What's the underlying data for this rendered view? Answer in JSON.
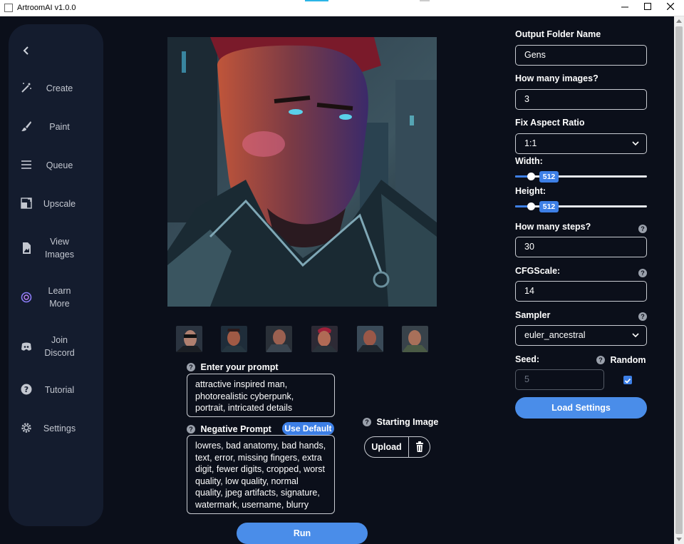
{
  "window": {
    "title": "ArtroomAI v1.0.0"
  },
  "sidebar": {
    "items": [
      {
        "label": "Create",
        "icon": "magic-wand-icon"
      },
      {
        "label": "Paint",
        "icon": "brush-icon"
      },
      {
        "label": "Queue",
        "icon": "list-icon"
      },
      {
        "label": "Upscale",
        "icon": "upscale-icon"
      },
      {
        "label": "View Images",
        "icon": "image-file-icon"
      },
      {
        "label": "Learn More",
        "icon": "openai-knot-icon"
      },
      {
        "label": "Join Discord",
        "icon": "discord-icon"
      },
      {
        "label": "Tutorial",
        "icon": "question-circle-icon"
      },
      {
        "label": "Settings",
        "icon": "gear-icon"
      }
    ]
  },
  "prompt": {
    "label": "Enter your prompt",
    "value": "attractive inspired man, photorealistic cyberpunk, portrait, intricated details"
  },
  "negative_prompt": {
    "label": "Negative Prompt",
    "use_default_label": "Use Default",
    "value": "lowres, bad anatomy, bad hands, text, error, missing fingers, extra digit, fewer digits, cropped, worst quality, low quality, normal quality, jpeg artifacts, signature, watermark, username, blurry"
  },
  "starting_image": {
    "label": "Starting Image",
    "upload_label": "Upload"
  },
  "run_label": "Run",
  "settings": {
    "output_folder": {
      "label": "Output Folder Name",
      "value": "Gens"
    },
    "num_images": {
      "label": "How many images?",
      "value": "3"
    },
    "aspect_ratio": {
      "label": "Fix Aspect Ratio",
      "value": "1:1"
    },
    "width": {
      "label": "Width:",
      "value": "512",
      "fraction": 0.12
    },
    "height": {
      "label": "Height:",
      "value": "512",
      "fraction": 0.12
    },
    "steps": {
      "label": "How many steps?",
      "value": "30"
    },
    "cfg_scale": {
      "label": "CFGScale:",
      "value": "14"
    },
    "sampler": {
      "label": "Sampler",
      "value": "euler_ancestral"
    },
    "seed": {
      "label": "Seed:",
      "placeholder": "5"
    },
    "random": {
      "label": "Random",
      "checked": true
    },
    "load_label": "Load Settings"
  },
  "colors": {
    "accent": "#3d7fe6",
    "background": "#0b0f1a",
    "sidebar": "#141c2e"
  }
}
